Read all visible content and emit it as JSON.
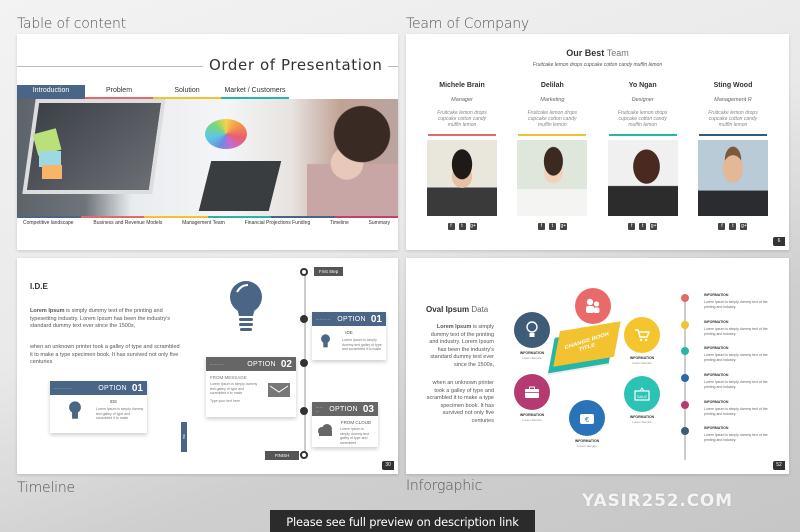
{
  "sections": {
    "top_left": "Table of content",
    "top_right": "Team of Company",
    "bottom_left": "Timeline",
    "bottom_right": "Inforgaphic"
  },
  "slide_toc": {
    "title": "Order of Presentation",
    "tabs": [
      {
        "label": "Introduction",
        "color": "#4a6585",
        "active": true
      },
      {
        "label": "Problem",
        "color": "#e06b6b"
      },
      {
        "label": "Solution",
        "color": "#f2c230"
      },
      {
        "label": "Market / Customers",
        "color": "#26b5a6"
      }
    ],
    "bottom_items": [
      {
        "label": "Competitive landscape",
        "color": "#4a6585"
      },
      {
        "label": "Business and Revenue Models",
        "color": "#e06b6b"
      },
      {
        "label": "Management Team",
        "color": "#f2c230"
      },
      {
        "label": "Financial Projections Funding",
        "color": "#26b5a6"
      },
      {
        "label": "Timeline",
        "color": "#4a6585"
      },
      {
        "label": "Summary",
        "color": "#c0406e"
      }
    ]
  },
  "slide_team": {
    "heading_bold": "Our Best",
    "heading_light": "Team",
    "subtitle": "Fruitcake lemon drops cupcake cotton candy muffin lemon",
    "page_number": "6",
    "members": [
      {
        "name": "Michele Brain",
        "role": "Manager",
        "desc": "Fruitcake lemon drops cupcake cotton candy muffin lemon",
        "color": "#e06b6b"
      },
      {
        "name": "Delilah",
        "role": "Marketing",
        "desc": "Fruitcake lemon drops cupcake cotton candy muffin lemon",
        "color": "#f2c230"
      },
      {
        "name": "Yo Ngan",
        "role": "Designer",
        "desc": "Fruitcake lemon drops cupcake cotton candy muffin lemon",
        "color": "#26b5a6"
      },
      {
        "name": "Sting Wood",
        "role": "Management R",
        "desc": "Fruitcake lemon drops cupcake cotton candy muffin lemon",
        "color": "#2e5c8a"
      }
    ],
    "social_icons": [
      "f",
      "t",
      "g+"
    ]
  },
  "slide_timeline": {
    "title": "I.D.E",
    "para1_bold": "Lorem Ipsum",
    "para1": " is simply dummy text of the printing and typesetting industry. Lorem Ipsum has been the industry's standard dummy text ever since the 1500s,",
    "para2": "when an unknown printer took a galley of type and scrambled it to make a type specimen book. It has survived not only five centuries",
    "first_step": "First Step",
    "finish": "FINISH",
    "side_tab": "IDE",
    "page_number": "30",
    "option_word": "OPTION",
    "options": [
      {
        "num": "01",
        "title": "IDE",
        "desc": "Lorem Ipsum is simply dummy text galley of type and scrambled it to make",
        "head_color": "#4a6585"
      },
      {
        "num": "02",
        "title": "FROM MESSAGE",
        "desc": "Lorem Ipsum is simply dummy text galley of type and scrambled it to make",
        "footer": "Type your text here",
        "head_color": "#666666"
      },
      {
        "num": "03",
        "title": "FROM CLOUD",
        "desc": "Lorem Ipsum is simply dummy text galley of type and scrambled",
        "head_color": "#666666"
      }
    ]
  },
  "slide_infographic": {
    "title_bold": "Oval Ipsum",
    "title_light": "Data",
    "para1_bold": "Lorem Ipsum",
    "para1": " is simply dummy text of the printing and industry. Lorem Ipsum has been the industry's standard dummy text ever since the 1500s,",
    "para2": "when an unknown printer took a galley of type and scrambled it to make a type specimen book. It has survived not only five centuries",
    "book_title": "CHANGE BOOK TITLE",
    "page_number": "52",
    "circles": [
      {
        "icon": "bulb",
        "label": "INFORMATION",
        "sub": "Lorem Service",
        "color": "#3e5b78"
      },
      {
        "icon": "people",
        "label": "INFORMATION",
        "sub": "Lorem Service",
        "color": "#ea6a6a"
      },
      {
        "icon": "cart",
        "label": "INFORMATION",
        "sub": "Lorem Service",
        "color": "#f4c52c"
      },
      {
        "icon": "sale",
        "label": "INFORMATION",
        "sub": "Lorem Service",
        "color": "#2cc2b4"
      },
      {
        "icon": "money-bag",
        "label": "INFORMATION",
        "sub": "Lorem Service",
        "color": "#2a73b8"
      },
      {
        "icon": "briefcase",
        "label": "INFORMATION",
        "sub": "Lorem Service",
        "color": "#b53a72"
      }
    ],
    "timeline": [
      {
        "head": "INFORMATION",
        "desc": "Lorem Ipsum is simply dummy text of the printing and industry.",
        "color": "#e06b6b"
      },
      {
        "head": "INFORMATION",
        "desc": "Lorem Ipsum is simply dummy text of the printing and industry.",
        "color": "#f2c230"
      },
      {
        "head": "INFORMATION",
        "desc": "Lorem Ipsum is simply dummy text of the printing and industry.",
        "color": "#26b5a6"
      },
      {
        "head": "INFORMATION",
        "desc": "Lorem Ipsum is simply dummy text of the printing and industry.",
        "color": "#2a6aa8"
      },
      {
        "head": "INFORMATION",
        "desc": "Lorem Ipsum is simply dummy text of the printing and industry.",
        "color": "#b53a72"
      },
      {
        "head": "INFORMATION",
        "desc": "Lorem Ipsum is simply dummy text of the printing and industry.",
        "color": "#3e5b78"
      }
    ]
  },
  "watermark": "YASIR252.COM",
  "notice": "Please see full preview on description link"
}
